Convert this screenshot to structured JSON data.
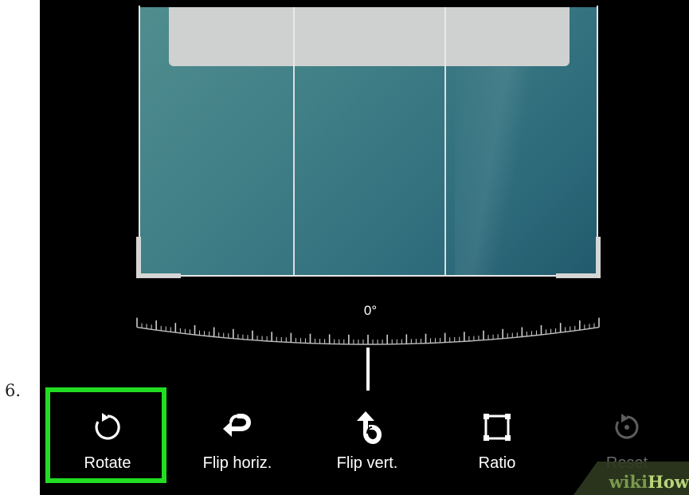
{
  "step": {
    "number": "6."
  },
  "editor": {
    "rotation_value": "0°",
    "toolbar": [
      {
        "id": "rotate",
        "label": "Rotate",
        "icon": "rotate-icon",
        "highlighted": true
      },
      {
        "id": "flip-horiz",
        "label": "Flip horiz.",
        "icon": "flip-horizontal-icon"
      },
      {
        "id": "flip-vert",
        "label": "Flip vert.",
        "icon": "flip-vertical-icon"
      },
      {
        "id": "ratio",
        "label": "Ratio",
        "icon": "ratio-icon"
      },
      {
        "id": "reset",
        "label": "Reset",
        "icon": "reset-icon",
        "disabled": true
      }
    ]
  },
  "watermark": {
    "wiki": "wiki",
    "how": "How"
  },
  "colors": {
    "highlight": "#22dd22",
    "background": "#000000",
    "text": "#ffffff"
  }
}
